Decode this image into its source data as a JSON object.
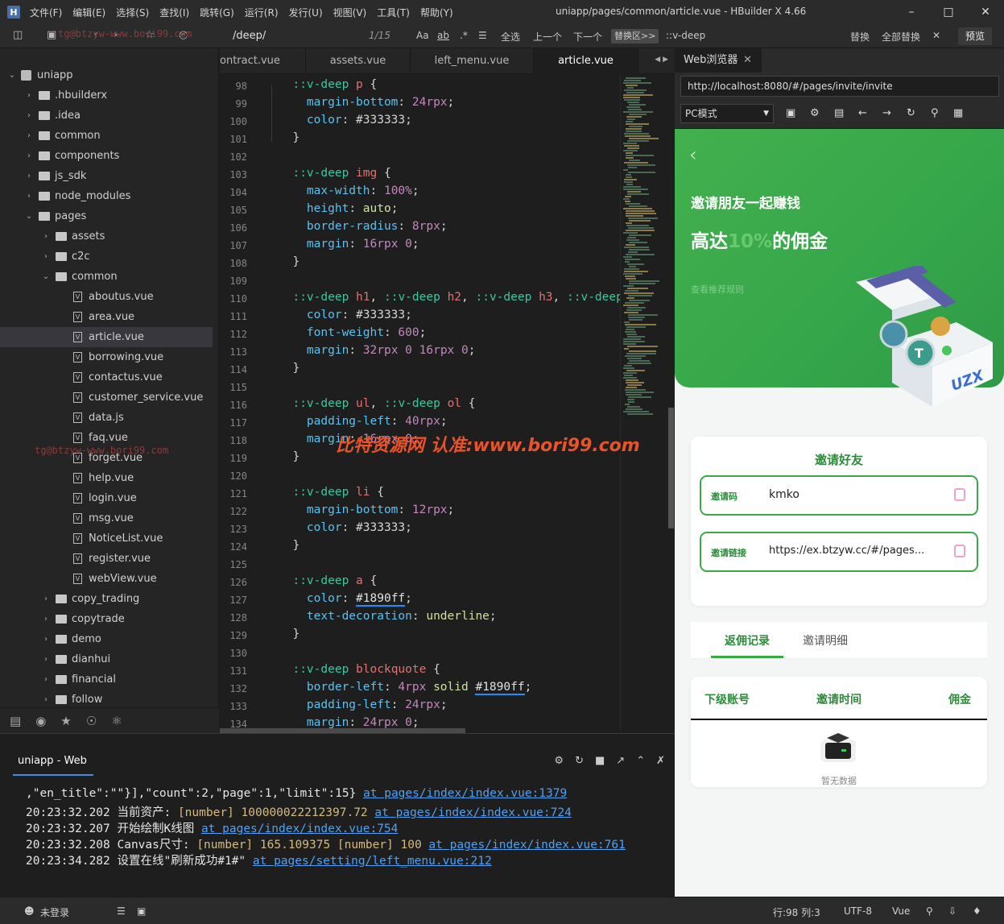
{
  "window": {
    "title": "uniapp/pages/common/article.vue - HBuilder X 4.66",
    "menu": [
      "文件(F)",
      "编辑(E)",
      "选择(S)",
      "查找(I)",
      "跳转(G)",
      "运行(R)",
      "发行(U)",
      "视图(V)",
      "工具(T)",
      "帮助(Y)"
    ]
  },
  "toolbar": {
    "search": "/deep/",
    "match_count": "1/15",
    "select_all": "全选",
    "prev": "上一个",
    "next": "下一个",
    "replace_region": "替换区>>",
    "replace_text": "::v-deep",
    "replace": "替换",
    "replace_all": "全部替换",
    "preview": "预览",
    "watermark": "tg@btzyw-www.bori99.com"
  },
  "sidebar": {
    "root": "uniapp",
    "items": [
      {
        "label": ".hbuilderx",
        "type": "folder",
        "depth": 1,
        "open": false
      },
      {
        "label": ".idea",
        "type": "folder",
        "depth": 1,
        "open": false
      },
      {
        "label": "common",
        "type": "folder",
        "depth": 1,
        "open": false
      },
      {
        "label": "components",
        "type": "folder",
        "depth": 1,
        "open": false
      },
      {
        "label": "js_sdk",
        "type": "folder",
        "depth": 1,
        "open": false
      },
      {
        "label": "node_modules",
        "type": "folder",
        "depth": 1,
        "open": false
      },
      {
        "label": "pages",
        "type": "folder",
        "depth": 1,
        "open": true
      },
      {
        "label": "assets",
        "type": "folder",
        "depth": 2,
        "open": false
      },
      {
        "label": "c2c",
        "type": "folder",
        "depth": 2,
        "open": false
      },
      {
        "label": "common",
        "type": "folder",
        "depth": 2,
        "open": true
      },
      {
        "label": "aboutus.vue",
        "type": "file",
        "depth": 3
      },
      {
        "label": "area.vue",
        "type": "file",
        "depth": 3
      },
      {
        "label": "article.vue",
        "type": "file",
        "depth": 3,
        "active": true
      },
      {
        "label": "borrowing.vue",
        "type": "file",
        "depth": 3
      },
      {
        "label": "contactus.vue",
        "type": "file",
        "depth": 3
      },
      {
        "label": "customer_service.vue",
        "type": "file",
        "depth": 3
      },
      {
        "label": "data.js",
        "type": "file",
        "depth": 3
      },
      {
        "label": "faq.vue",
        "type": "file",
        "depth": 3
      },
      {
        "label": "forget.vue",
        "type": "file",
        "depth": 3
      },
      {
        "label": "help.vue",
        "type": "file",
        "depth": 3
      },
      {
        "label": "login.vue",
        "type": "file",
        "depth": 3
      },
      {
        "label": "msg.vue",
        "type": "file",
        "depth": 3
      },
      {
        "label": "NoticeList.vue",
        "type": "file",
        "depth": 3
      },
      {
        "label": "register.vue",
        "type": "file",
        "depth": 3
      },
      {
        "label": "webView.vue",
        "type": "file",
        "depth": 3
      },
      {
        "label": "copy_trading",
        "type": "folder",
        "depth": 2,
        "open": false
      },
      {
        "label": "copytrade",
        "type": "folder",
        "depth": 2,
        "open": false
      },
      {
        "label": "demo",
        "type": "folder",
        "depth": 2,
        "open": false
      },
      {
        "label": "dianhui",
        "type": "folder",
        "depth": 2,
        "open": false
      },
      {
        "label": "financial",
        "type": "folder",
        "depth": 2,
        "open": false
      },
      {
        "label": "follow",
        "type": "folder",
        "depth": 2,
        "open": false
      }
    ],
    "watermark": "tg@btzyw-www.bori99.com"
  },
  "tabs": [
    {
      "label": "ontract.vue"
    },
    {
      "label": "assets.vue"
    },
    {
      "label": "left_menu.vue"
    },
    {
      "label": "article.vue",
      "active": true
    }
  ],
  "editor": {
    "lines": [
      {
        "n": "98",
        "t": [
          [
            "  ",
            "p"
          ],
          [
            "::v-deep ",
            "s"
          ],
          [
            "p ",
            "t"
          ],
          [
            "{",
            "p"
          ]
        ]
      },
      {
        "n": "99",
        "t": [
          [
            "    ",
            "p"
          ],
          [
            "margin-bottom",
            "k"
          ],
          [
            ": ",
            "p"
          ],
          [
            "24rpx",
            "n"
          ],
          [
            ";",
            "p"
          ]
        ]
      },
      {
        "n": "100",
        "t": [
          [
            "    ",
            "p"
          ],
          [
            "color",
            "k"
          ],
          [
            ": #333333;",
            "p"
          ]
        ]
      },
      {
        "n": "101",
        "t": [
          [
            "  }",
            "p"
          ]
        ]
      },
      {
        "n": "102",
        "t": []
      },
      {
        "n": "103",
        "t": [
          [
            "  ",
            "p"
          ],
          [
            "::v-deep ",
            "s"
          ],
          [
            "img ",
            "t"
          ],
          [
            "{",
            "p"
          ]
        ]
      },
      {
        "n": "104",
        "t": [
          [
            "    ",
            "p"
          ],
          [
            "max-width",
            "k"
          ],
          [
            ": ",
            "p"
          ],
          [
            "100%",
            "n"
          ],
          [
            ";",
            "p"
          ]
        ]
      },
      {
        "n": "105",
        "t": [
          [
            "    ",
            "p"
          ],
          [
            "height",
            "k"
          ],
          [
            ": ",
            "p"
          ],
          [
            "auto",
            "v"
          ],
          [
            ";",
            "p"
          ]
        ]
      },
      {
        "n": "106",
        "t": [
          [
            "    ",
            "p"
          ],
          [
            "border-radius",
            "k"
          ],
          [
            ": ",
            "p"
          ],
          [
            "8rpx",
            "n"
          ],
          [
            ";",
            "p"
          ]
        ]
      },
      {
        "n": "107",
        "t": [
          [
            "    ",
            "p"
          ],
          [
            "margin",
            "k"
          ],
          [
            ": ",
            "p"
          ],
          [
            "16rpx ",
            "n"
          ],
          [
            "0",
            "n"
          ],
          [
            ";",
            "p"
          ]
        ]
      },
      {
        "n": "108",
        "t": [
          [
            "  }",
            "p"
          ]
        ]
      },
      {
        "n": "109",
        "t": []
      },
      {
        "n": "110",
        "t": [
          [
            "  ",
            "p"
          ],
          [
            "::v-deep ",
            "s"
          ],
          [
            "h1",
            "t"
          ],
          [
            ", ",
            "p"
          ],
          [
            "::v-deep ",
            "s"
          ],
          [
            "h2",
            "t"
          ],
          [
            ", ",
            "p"
          ],
          [
            "::v-deep ",
            "s"
          ],
          [
            "h3",
            "t"
          ],
          [
            ", ",
            "p"
          ],
          [
            "::v-deep",
            "s"
          ]
        ]
      },
      {
        "n": "111",
        "t": [
          [
            "    ",
            "p"
          ],
          [
            "color",
            "k"
          ],
          [
            ": #333333;",
            "p"
          ]
        ]
      },
      {
        "n": "112",
        "t": [
          [
            "    ",
            "p"
          ],
          [
            "font-weight",
            "k"
          ],
          [
            ": ",
            "p"
          ],
          [
            "600",
            "n"
          ],
          [
            ";",
            "p"
          ]
        ]
      },
      {
        "n": "113",
        "t": [
          [
            "    ",
            "p"
          ],
          [
            "margin",
            "k"
          ],
          [
            ": ",
            "p"
          ],
          [
            "32rpx ",
            "n"
          ],
          [
            "0 ",
            "n"
          ],
          [
            "16rpx ",
            "n"
          ],
          [
            "0",
            "n"
          ],
          [
            ";",
            "p"
          ]
        ]
      },
      {
        "n": "114",
        "t": [
          [
            "  }",
            "p"
          ]
        ]
      },
      {
        "n": "115",
        "t": []
      },
      {
        "n": "116",
        "t": [
          [
            "  ",
            "p"
          ],
          [
            "::v-deep ",
            "s"
          ],
          [
            "ul",
            "t"
          ],
          [
            ", ",
            "p"
          ],
          [
            "::v-deep ",
            "s"
          ],
          [
            "ol ",
            "t"
          ],
          [
            "{",
            "p"
          ]
        ]
      },
      {
        "n": "117",
        "t": [
          [
            "    ",
            "p"
          ],
          [
            "padding-left",
            "k"
          ],
          [
            ": ",
            "p"
          ],
          [
            "40rpx",
            "n"
          ],
          [
            ";",
            "p"
          ]
        ]
      },
      {
        "n": "118",
        "t": [
          [
            "    ",
            "p"
          ],
          [
            "margin",
            "k"
          ],
          [
            ": ",
            "p"
          ],
          [
            "16rpx ",
            "n"
          ],
          [
            "0",
            "n"
          ],
          [
            ";",
            "p"
          ]
        ]
      },
      {
        "n": "119",
        "t": [
          [
            "  }",
            "p"
          ]
        ]
      },
      {
        "n": "120",
        "t": []
      },
      {
        "n": "121",
        "t": [
          [
            "  ",
            "p"
          ],
          [
            "::v-deep ",
            "s"
          ],
          [
            "li ",
            "t"
          ],
          [
            "{",
            "p"
          ]
        ]
      },
      {
        "n": "122",
        "t": [
          [
            "    ",
            "p"
          ],
          [
            "margin-bottom",
            "k"
          ],
          [
            ": ",
            "p"
          ],
          [
            "12rpx",
            "n"
          ],
          [
            ";",
            "p"
          ]
        ]
      },
      {
        "n": "123",
        "t": [
          [
            "    ",
            "p"
          ],
          [
            "color",
            "k"
          ],
          [
            ": #333333;",
            "p"
          ]
        ]
      },
      {
        "n": "124",
        "t": [
          [
            "  }",
            "p"
          ]
        ]
      },
      {
        "n": "125",
        "t": []
      },
      {
        "n": "126",
        "t": [
          [
            "  ",
            "p"
          ],
          [
            "::v-deep ",
            "s"
          ],
          [
            "a ",
            "t"
          ],
          [
            "{",
            "p"
          ]
        ]
      },
      {
        "n": "127",
        "t": [
          [
            "    ",
            "p"
          ],
          [
            "color",
            "k"
          ],
          [
            ": ",
            "p"
          ],
          [
            "#1890ff",
            "h"
          ],
          [
            ";",
            "p"
          ]
        ]
      },
      {
        "n": "128",
        "t": [
          [
            "    ",
            "p"
          ],
          [
            "text-decoration",
            "k"
          ],
          [
            ": ",
            "p"
          ],
          [
            "underline",
            "v"
          ],
          [
            ";",
            "p"
          ]
        ]
      },
      {
        "n": "129",
        "t": [
          [
            "  }",
            "p"
          ]
        ]
      },
      {
        "n": "130",
        "t": []
      },
      {
        "n": "131",
        "t": [
          [
            "  ",
            "p"
          ],
          [
            "::v-deep ",
            "s"
          ],
          [
            "blockquote ",
            "t"
          ],
          [
            "{",
            "p"
          ]
        ]
      },
      {
        "n": "132",
        "t": [
          [
            "    ",
            "p"
          ],
          [
            "border-left",
            "k"
          ],
          [
            ": ",
            "p"
          ],
          [
            "4rpx ",
            "n"
          ],
          [
            "solid ",
            "v"
          ],
          [
            "#1890ff",
            "h"
          ],
          [
            ";",
            "p"
          ]
        ]
      },
      {
        "n": "133",
        "t": [
          [
            "    ",
            "p"
          ],
          [
            "padding-left",
            "k"
          ],
          [
            ": ",
            "p"
          ],
          [
            "24rpx",
            "n"
          ],
          [
            ";",
            "p"
          ]
        ]
      },
      {
        "n": "134",
        "t": [
          [
            "    ",
            "p"
          ],
          [
            "margin",
            "k"
          ],
          [
            ": ",
            "p"
          ],
          [
            "24rpx ",
            "n"
          ],
          [
            "0",
            "n"
          ],
          [
            ";",
            "p"
          ]
        ]
      }
    ],
    "watermark": "比特资源网 认准:www.bori99.com"
  },
  "console": {
    "tab": "uniapp - Web",
    "lines": [
      [
        [
          ",\"en_title\":\"\"}],\"count\":2,\"page\":1,\"limit\":15} ",
          "x"
        ],
        [
          "at pages/index/index.vue:1379",
          "l"
        ]
      ],
      [
        [
          "20:23:32.202 当前资产: ",
          "x"
        ],
        [
          "[number] 100000022212397.72 ",
          "t"
        ],
        [
          "at pages/index/index.vue:724",
          "l"
        ]
      ],
      [
        [
          "20:23:32.207 开始绘制K线图 ",
          "x"
        ],
        [
          "at pages/index/index.vue:754",
          "l"
        ]
      ],
      [
        [
          "20:23:32.208 Canvas尺寸: ",
          "x"
        ],
        [
          "[number] 165.109375 [number] 100 ",
          "t"
        ],
        [
          "at pages/index/index.vue:761",
          "l"
        ]
      ],
      [
        [
          "20:23:34.282 设置在线\"刷新成功#1#\" ",
          "x"
        ],
        [
          "at pages/setting/left_menu.vue:212",
          "l"
        ]
      ]
    ]
  },
  "status": {
    "login": "未登录",
    "position": "行:98  列:3",
    "encoding": "UTF-8",
    "language": "Vue"
  },
  "browser": {
    "tab": "Web浏览器",
    "url": "http://localhost:8080/#/pages/invite/invite",
    "mode": "PC模式",
    "page": {
      "headline": "邀请朋友一起赚钱",
      "big_prefix": "高达",
      "big_pct": "10%",
      "big_suffix": "的佣金",
      "rules": "查看推荐规则",
      "box_brand": "UZX",
      "invite_title": "邀请好友",
      "code_label": "邀请码",
      "code_value": "kmko",
      "link_label": "邀请链接",
      "link_value": "https://ex.btzyw.cc/#/pages...",
      "tab_records": "返佣记录",
      "tab_details": "邀请明细",
      "col_account": "下级账号",
      "col_time": "邀请时间",
      "col_commission": "佣金",
      "empty": "暂无数据"
    }
  },
  "colors": {
    "accent_green": "#3aaa46",
    "link_blue": "#1890ff",
    "watermark_orange": "#e8532a"
  }
}
